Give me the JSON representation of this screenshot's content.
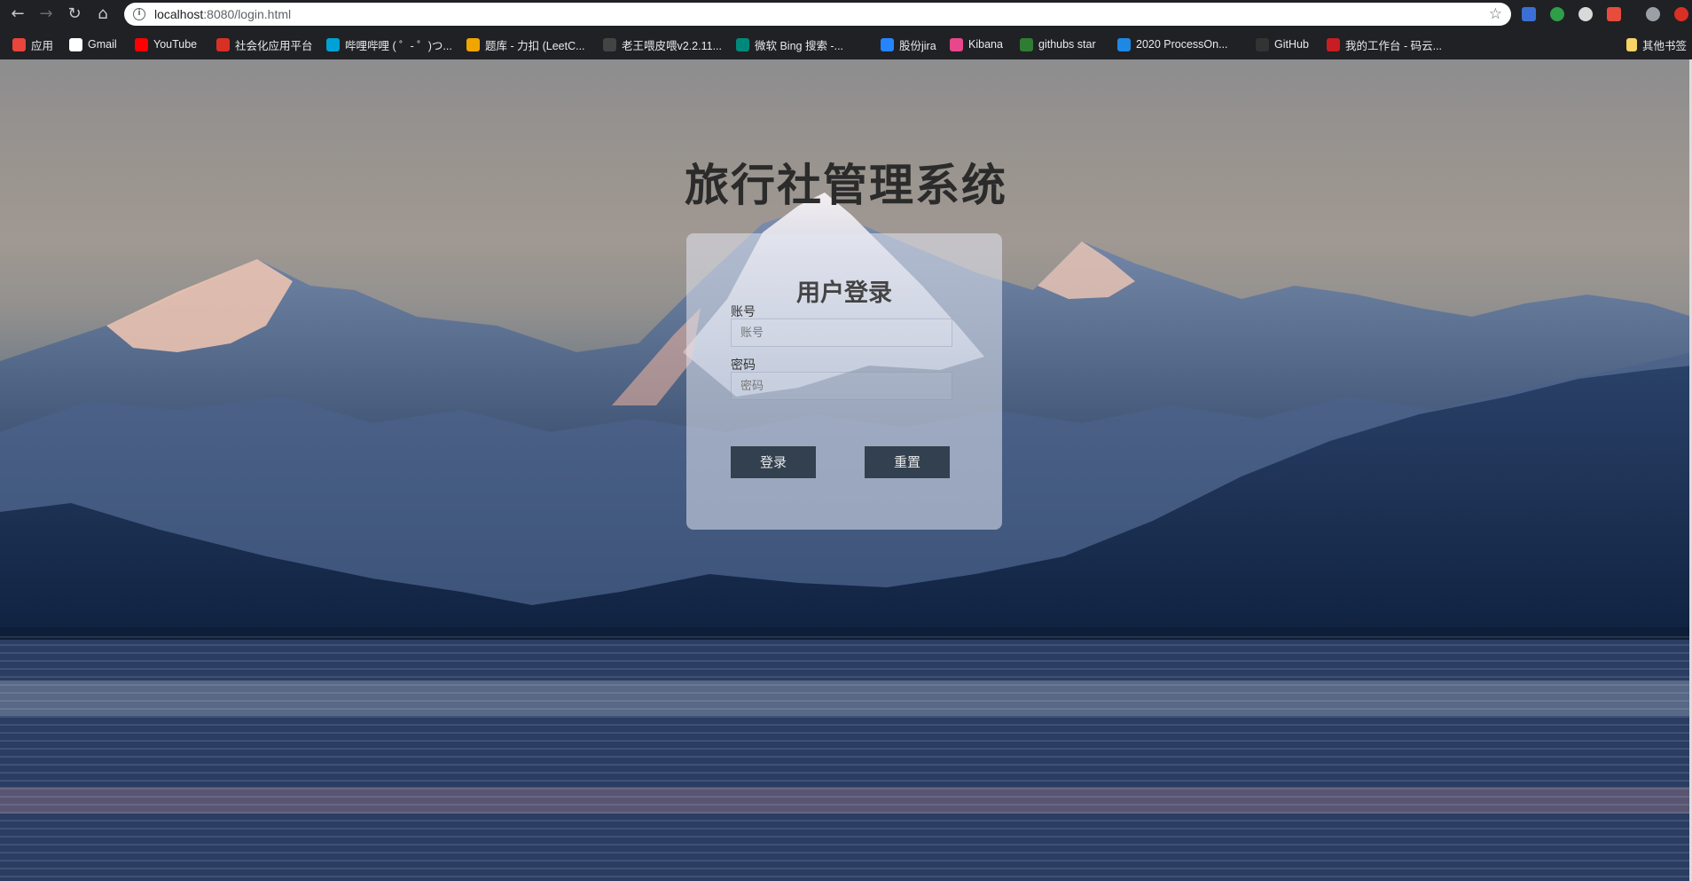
{
  "browser": {
    "url_host": "localhost",
    "url_rest": ":8080/login.html",
    "bookmarks": [
      {
        "label": "应用",
        "icon": "apps-grid-icon",
        "color": "#e8453c"
      },
      {
        "label": "Gmail",
        "icon": "google-icon",
        "color": "#ffffff"
      },
      {
        "label": "YouTube",
        "icon": "youtube-icon",
        "color": "#ff0000"
      },
      {
        "label": "社会化应用平台",
        "icon": "social-platform-icon",
        "color": "#d93025"
      },
      {
        "label": "哔哩哔哩 ( ゜- ゜)つ...",
        "icon": "bilibili-icon",
        "color": "#00a1d6"
      },
      {
        "label": "题库 - 力扣 (LeetC...",
        "icon": "leetcode-icon",
        "color": "#f0a500"
      },
      {
        "label": "老王喂皮喂v2.2.11...",
        "icon": "github-cat-icon",
        "color": "#444444"
      },
      {
        "label": "微软 Bing 搜索 -...",
        "icon": "bing-icon",
        "color": "#00897b"
      },
      {
        "label": "股份jira",
        "icon": "jira-icon",
        "color": "#2684ff"
      },
      {
        "label": "Kibana",
        "icon": "kibana-icon",
        "color": "#e8478b"
      },
      {
        "label": "githubs star",
        "icon": "turtle-icon",
        "color": "#2e7d32"
      },
      {
        "label": "2020 ProcessOn...",
        "icon": "processon-icon",
        "color": "#1e88e5"
      },
      {
        "label": "GitHub",
        "icon": "github-icon",
        "color": "#333333"
      },
      {
        "label": "我的工作台 - 码云...",
        "icon": "gitee-icon",
        "color": "#c71d23"
      }
    ],
    "other_bookmarks": "其他书签"
  },
  "page": {
    "system_title": "旅行社管理系统",
    "card_title": "用户登录",
    "account_label": "账号",
    "account_placeholder": "账号",
    "password_label": "密码",
    "password_placeholder": "密码",
    "login_button": "登录",
    "reset_button": "重置"
  },
  "colors": {
    "button_bg": "#33404f",
    "title_color": "#2b2b2b"
  }
}
